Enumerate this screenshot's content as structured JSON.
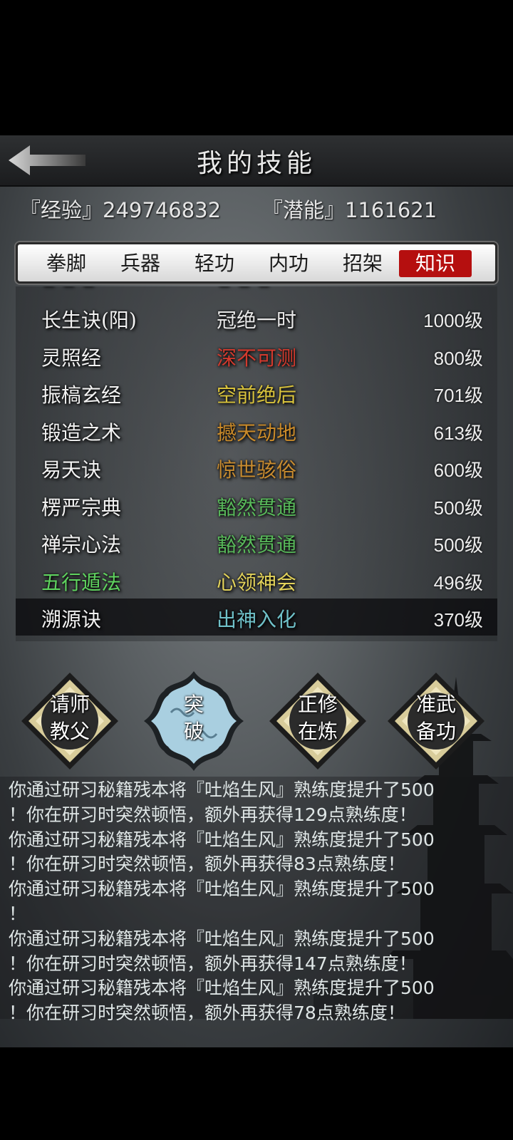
{
  "header": {
    "title": "我的技能"
  },
  "stats": {
    "exp_label": "『经验』",
    "exp_value": "249746832",
    "pot_label": "『潜能』",
    "pot_value": "1161621"
  },
  "tabs": [
    {
      "label": "拳脚",
      "active": false
    },
    {
      "label": "兵器",
      "active": false
    },
    {
      "label": "轻功",
      "active": false
    },
    {
      "label": "内功",
      "active": false
    },
    {
      "label": "招架",
      "active": false
    },
    {
      "label": "知识",
      "active": true
    }
  ],
  "skills": [
    {
      "name": "长生诀(阳)",
      "realm": "冠绝一时",
      "realm_color": "#e8e8e8",
      "level": "1000级"
    },
    {
      "name": "灵照经",
      "realm": "深不可测",
      "realm_color": "#d23a2e",
      "level": "800级"
    },
    {
      "name": "振槁玄经",
      "realm": "空前绝后",
      "realm_color": "#d8c23c",
      "level": "701级"
    },
    {
      "name": "锻造之术",
      "realm": "撼天动地",
      "realm_color": "#c98a2a",
      "level": "613级"
    },
    {
      "name": "易天诀",
      "realm": "惊世骇俗",
      "realm_color": "#c78b30",
      "level": "600级"
    },
    {
      "name": "楞严宗典",
      "realm": "豁然贯通",
      "realm_color": "#58b85a",
      "level": "500级"
    },
    {
      "name": "禅宗心法",
      "realm": "豁然贯通",
      "realm_color": "#58b85a",
      "level": "500级"
    },
    {
      "name": "五行遁法",
      "realm": "心领神会",
      "realm_color": "#e2d25a",
      "level": "496级",
      "name_green": true
    },
    {
      "name": "溯源诀",
      "realm": "出神入化",
      "realm_color": "#6fc0c8",
      "level": "370级",
      "selected": true
    }
  ],
  "actions": [
    {
      "line1": "请师",
      "line2": "教父"
    },
    {
      "line1": "突",
      "line2": "破"
    },
    {
      "line1": "正修",
      "line2": "在炼"
    },
    {
      "line1": "准武",
      "line2": "备功"
    }
  ],
  "log": [
    "你通过研习秘籍残本将『吐焰生风』熟练度提升了500",
    "！你在研习时突然顿悟，额外再获得129点熟练度！",
    "你通过研习秘籍残本将『吐焰生风』熟练度提升了500",
    "！你在研习时突然顿悟，额外再获得83点熟练度！",
    "你通过研习秘籍残本将『吐焰生风』熟练度提升了500",
    "！",
    "你通过研习秘籍残本将『吐焰生风』熟练度提升了500",
    "！你在研习时突然顿悟，额外再获得147点熟练度！",
    "你通过研习秘籍残本将『吐焰生风』熟练度提升了500",
    "！你在研习时突然顿悟，额外再获得78点熟练度！"
  ],
  "icons": {
    "back": "back-arrow-icon",
    "scenery": "pagoda-silhouette"
  }
}
